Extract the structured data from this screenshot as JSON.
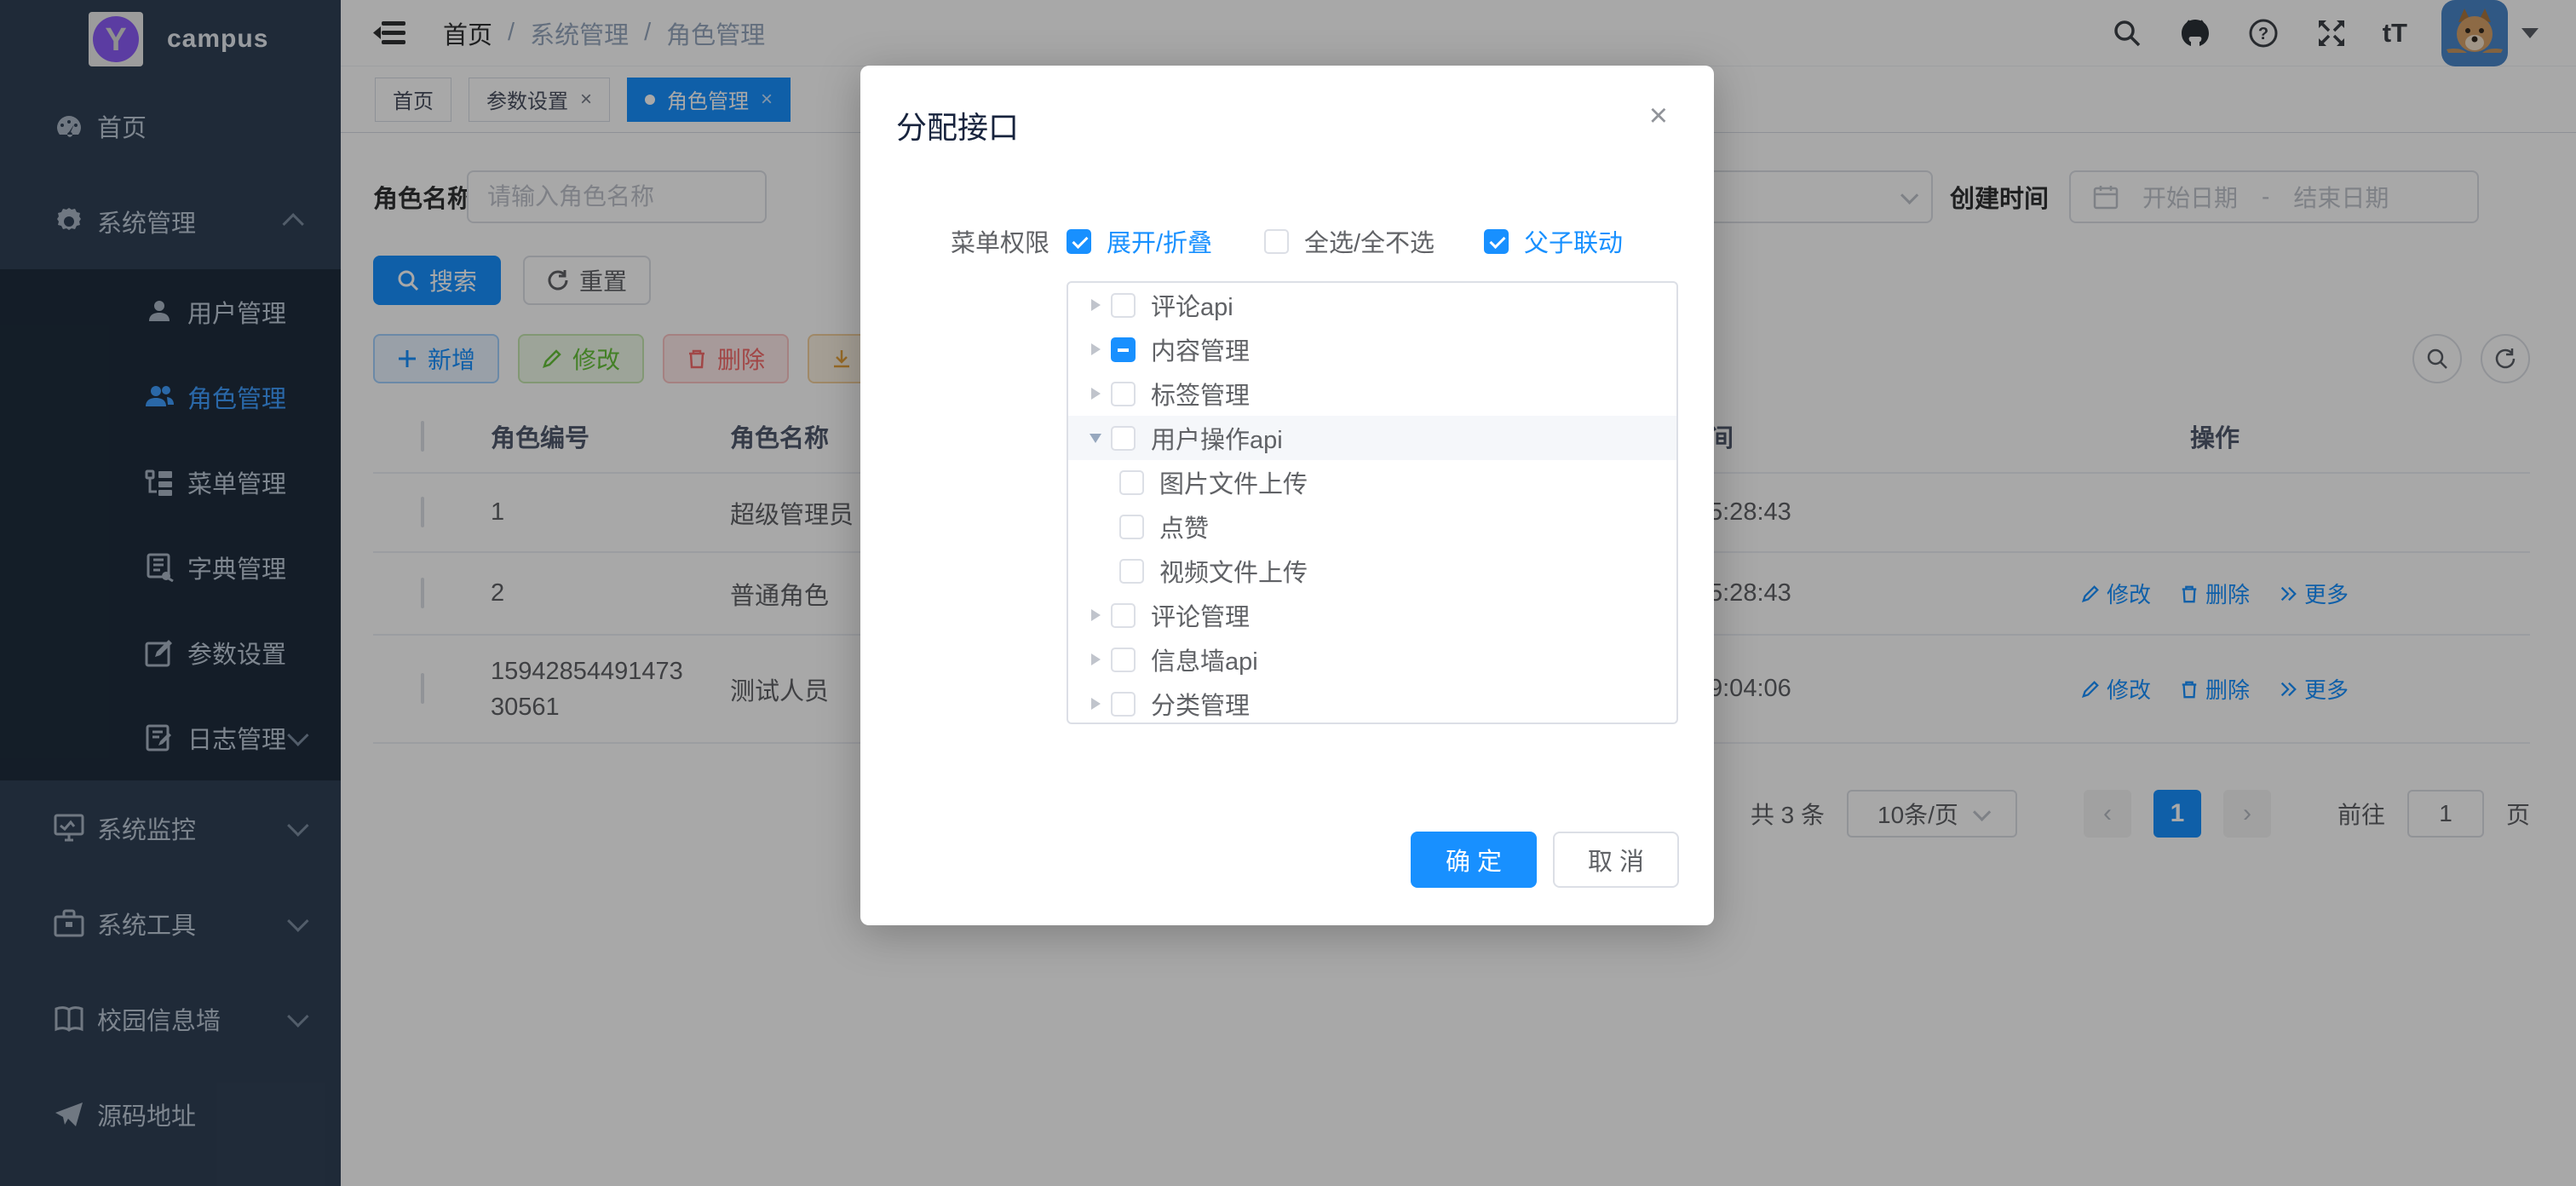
{
  "colors": {
    "primary": "#1890ff",
    "sidebar-bg": "#304156",
    "submenu-bg": "#1f2d3d",
    "sidebar-text": "#bfcbd9",
    "active-blue": "#409eff",
    "success": "#67c23a",
    "danger": "#f56c6c",
    "warning": "#e6a23c",
    "logo-purple": "#8b5cf6"
  },
  "sidebar": {
    "logo_text": "campus",
    "logo_letter": "Y",
    "items": {
      "home": "首页",
      "system": "系统管理",
      "monitor": "系统监控",
      "tools": "系统工具",
      "wall": "校园信息墙",
      "source": "源码地址"
    },
    "system_children": {
      "user": "用户管理",
      "role": "角色管理",
      "menu": "菜单管理",
      "dict": "字典管理",
      "param": "参数设置",
      "log": "日志管理"
    }
  },
  "navbar": {
    "breadcrumb": {
      "home": "首页",
      "sep1": "/",
      "system": "系统管理",
      "sep2": "/",
      "role": "角色管理"
    },
    "font_size_icon_text": "tT"
  },
  "tags": {
    "home": "首页",
    "param": "参数设置",
    "role": "角色管理",
    "close_icon": "×"
  },
  "search": {
    "name_label": "角色名称",
    "name_placeholder": "请输入角色名称",
    "created_label": "创建时间",
    "date_start_placeholder": "开始日期",
    "date_separator": "-",
    "date_end_placeholder": "结束日期"
  },
  "toolbar": {
    "search_label": "搜索",
    "reset_label": "重置",
    "add_label": "新增",
    "edit_label": "修改",
    "delete_label": "删除",
    "export_label": "导出"
  },
  "table": {
    "headers": {
      "id": "角色编号",
      "name": "角色名称",
      "created_fragment": "间",
      "op": "操作"
    },
    "rows": [
      {
        "id": "1",
        "name": "超级管理员",
        "created_fragment": "5:28:43",
        "op_edit": "",
        "op_delete": "",
        "op_more": ""
      },
      {
        "id": "2",
        "name": "普通角色",
        "created_fragment": "5:28:43",
        "op_edit": "修改",
        "op_delete": "删除",
        "op_more": "更多"
      },
      {
        "id": "1594285449147330561",
        "name": "测试人员",
        "created_fragment": "9:04:06",
        "op_edit": "修改",
        "op_delete": "删除",
        "op_more": "更多"
      }
    ]
  },
  "pagination": {
    "total": "共 3 条",
    "page_size": "10条/页",
    "prev": "‹",
    "current": "1",
    "next": "›",
    "goto_label": "前往",
    "goto_value": "1",
    "goto_unit": "页"
  },
  "modal": {
    "title": "分配接口",
    "close_icon": "×",
    "perm_label": "菜单权限",
    "checks": {
      "expand": "展开/折叠",
      "select_all": "全选/全不选",
      "link": "父子联动"
    },
    "tree": [
      {
        "label": "评论api"
      },
      {
        "label": "内容管理"
      },
      {
        "label": "标签管理"
      },
      {
        "label": "用户操作api"
      },
      {
        "label": "图片文件上传"
      },
      {
        "label": "点赞"
      },
      {
        "label": "视频文件上传"
      },
      {
        "label": "评论管理"
      },
      {
        "label": "信息墙api"
      },
      {
        "label": "分类管理"
      }
    ],
    "confirm_label": "确 定",
    "cancel_label": "取 消"
  }
}
